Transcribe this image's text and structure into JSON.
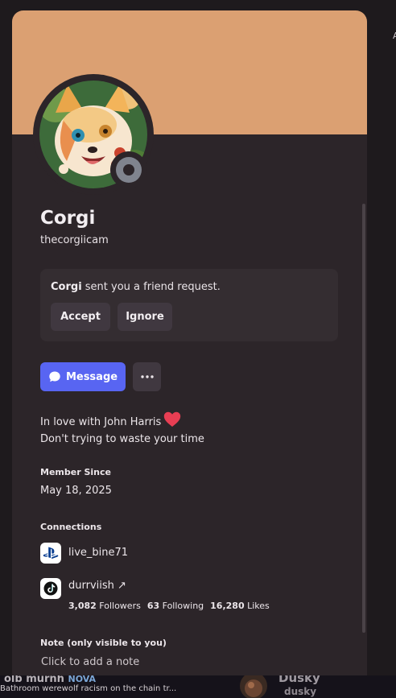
{
  "colors": {
    "banner": "#dba072",
    "card_background": "#2c2529",
    "accent": "#5865f2",
    "status_offline": "#80848e",
    "heart": "#e83e53"
  },
  "profile": {
    "display_name": "Corgi",
    "username": "thecorgiicam",
    "status": "offline",
    "avatar_icon": "corgi-avatar-art"
  },
  "friend_request": {
    "sender": "Corgi",
    "text": " sent you a friend request.",
    "accept_label": "Accept",
    "ignore_label": "Ignore"
  },
  "actions": {
    "message_label": "Message",
    "message_icon": "chat-bubble-icon",
    "more_icon": "ellipsis-icon"
  },
  "bio": {
    "line1": "In love with John Harris",
    "line1_emoji": "red-heart",
    "line2": "Don't trying to waste your time"
  },
  "member_since": {
    "title": "Member Since",
    "date": "May 18, 2025"
  },
  "connections": {
    "title": "Connections",
    "items": [
      {
        "platform": "playstation",
        "icon": "playstation-icon",
        "name": "live_bine71"
      },
      {
        "platform": "tiktok",
        "icon": "tiktok-icon",
        "name": "durrviish ↗",
        "stats": {
          "followers": "3,082",
          "followers_label": " Followers",
          "following": "63",
          "following_label": " Following",
          "likes": "16,280",
          "likes_label": " Likes"
        }
      }
    ]
  },
  "note": {
    "title": "Note (only visible to you)",
    "placeholder": "Click to add a note"
  },
  "background": {
    "left_name": "olb murnh",
    "left_tag": "NOVA",
    "left_description": "Bathroom werewolf racism on the chain tr...",
    "right_name": "Dusky",
    "right_sub": "dusky",
    "edge_glyph": "A"
  }
}
